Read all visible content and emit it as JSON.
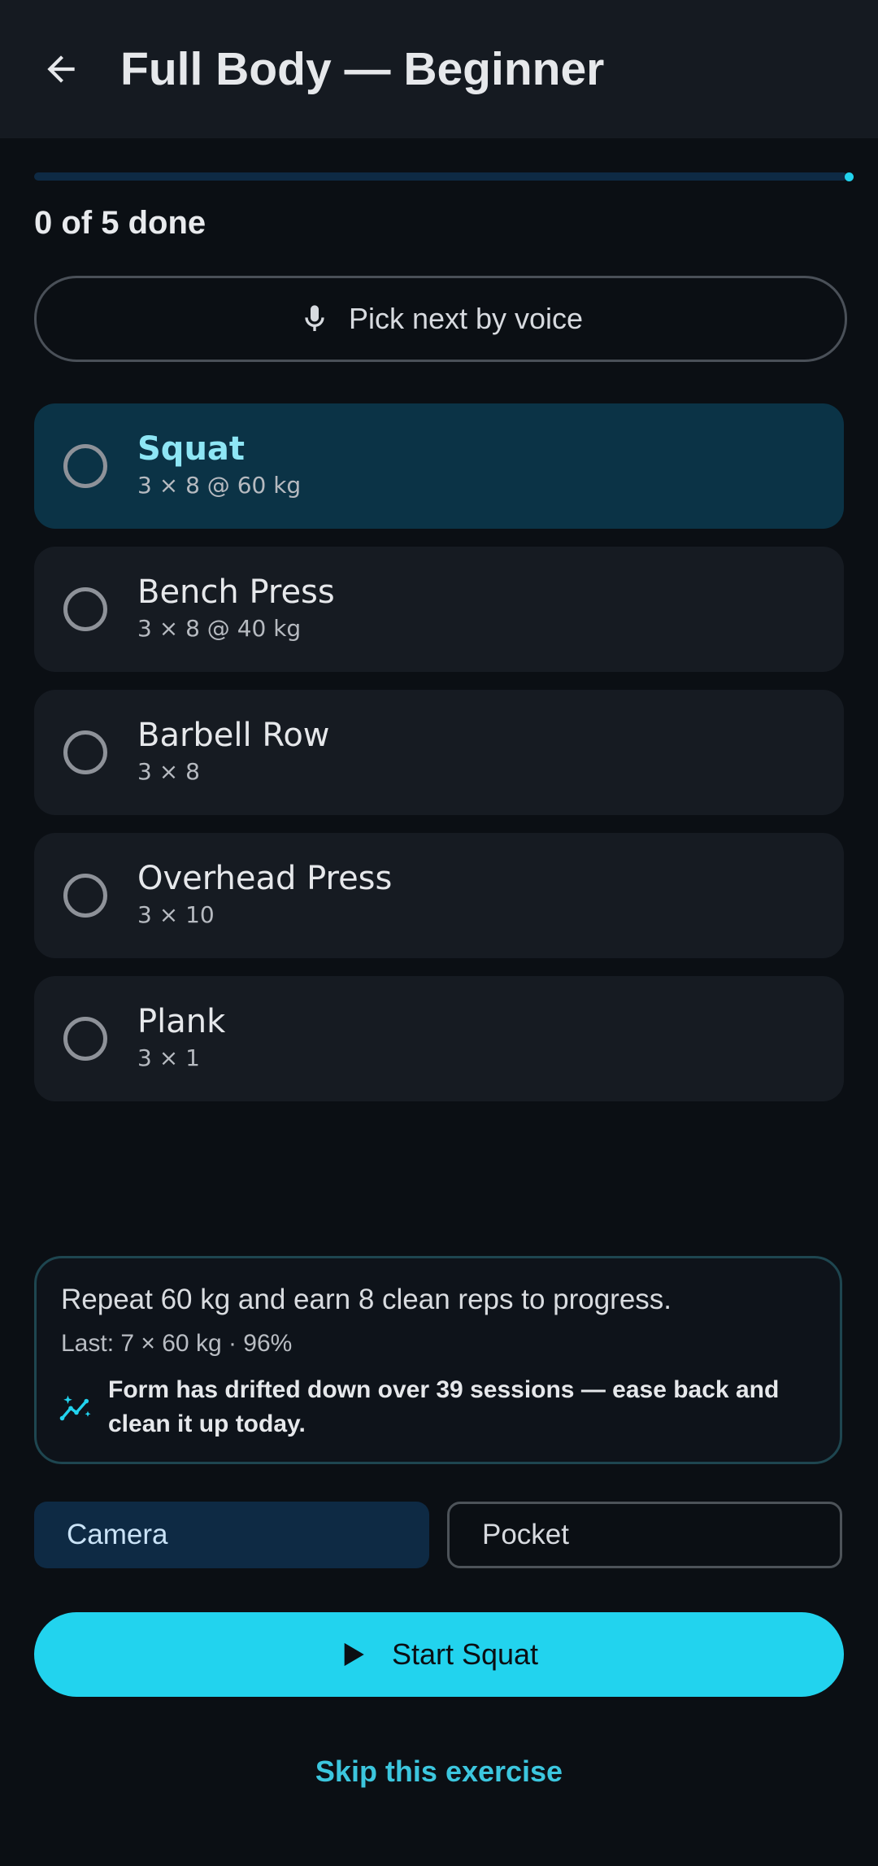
{
  "header": {
    "title": "Full Body — Beginner",
    "back_icon": "arrow-left-icon"
  },
  "progress": {
    "completed": 0,
    "total": 5,
    "fraction": 0,
    "label": "0 of 5 done",
    "color": "#22d3ee",
    "track_color": "#0e2a44"
  },
  "voice": {
    "label": "Pick next by voice",
    "icon": "microphone-icon"
  },
  "exercises": [
    {
      "name": "Squat",
      "detail": "3 × 8 @ 60 kg",
      "selected": true,
      "done": false
    },
    {
      "name": "Bench Press",
      "detail": "3 × 8 @ 40 kg",
      "selected": false,
      "done": false
    },
    {
      "name": "Barbell Row",
      "detail": "3 × 8",
      "selected": false,
      "done": false
    },
    {
      "name": "Overhead Press",
      "detail": "3 × 10",
      "selected": false,
      "done": false
    },
    {
      "name": "Plank",
      "detail": "3 × 1",
      "selected": false,
      "done": false
    }
  ],
  "recommendation": {
    "main": "Repeat 60 kg and earn 8 clean reps to progress.",
    "last": "Last: 7 × 60 kg · 96%",
    "trend_icon": "trending-sparkle-icon",
    "trend_text": "Form has drifted down over 39 sessions — ease back and clean it up today."
  },
  "tracking_mode": {
    "options": [
      "Camera",
      "Pocket"
    ],
    "selected": "Camera"
  },
  "start": {
    "label": "Start Squat",
    "icon": "play-icon"
  },
  "skip": {
    "label": "Skip this exercise"
  },
  "colors": {
    "accent": "#22d3ee",
    "background": "#0b0f14",
    "card": "#161b22",
    "card_selected": "#0b3346"
  }
}
